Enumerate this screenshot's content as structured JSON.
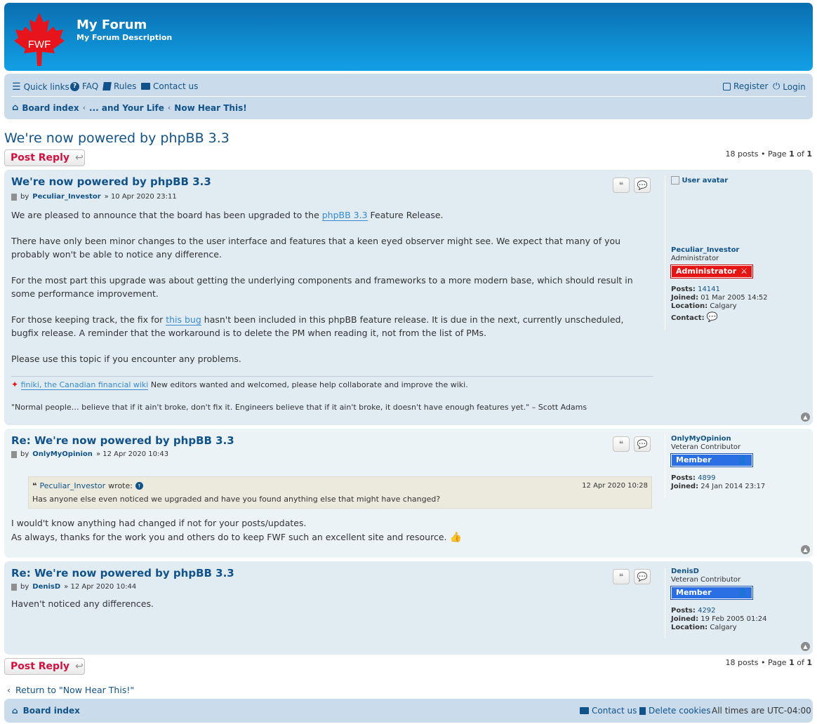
{
  "header": {
    "site_title": "My Forum",
    "site_description": "My Forum Description",
    "logo_text": "FWF"
  },
  "navbar": {
    "quick_links": "Quick links",
    "faq": "FAQ",
    "rules": "Rules",
    "contact": "Contact us",
    "register": "Register",
    "login": "Login",
    "breadcrumb": [
      "Board index",
      "... and Your Life",
      "Now Hear This!"
    ]
  },
  "topic": {
    "title": "We're now powered by phpBB 3.3",
    "post_reply": "Post Reply",
    "pagination_prefix": "18 posts • Page",
    "page_current": "1",
    "page_of": "of",
    "page_total": "1"
  },
  "posts": [
    {
      "title": "We're now powered by phpBB 3.3",
      "by": "by",
      "author": "Peculiar_Investor",
      "date": "» 10 Apr 2020 23:11",
      "p1_pre": "We are pleased to announce that the board has been upgraded to the ",
      "p1_link": "phpBB 3.3",
      "p1_post": " Feature Release.",
      "p2": "There have only been minor changes to the user interface and features that a keen eyed observer might see. We expect that many of you probably won't be able to notice any difference.",
      "p3": "For the most part this upgrade was about getting the underlying components and frameworks to a more modern base, which should result in some performance improvement.",
      "p4_pre": "For those keeping track, the fix for ",
      "p4_link": "this bug",
      "p4_post": " hasn't been included in this phpBB feature release. It is due in the next, currently unscheduled, bugfix release. A reminder that the workaround is to delete the PM when reading it, not from the list of PMs.",
      "p5": "Please use this topic if you encounter any problems.",
      "sig_link": "finiki, the Canadian financial wiki",
      "sig_text": " New editors wanted and welcomed, please help collaborate and improve the wiki.",
      "sig_quote": "\"Normal people… believe that if it ain't broke, don't fix it. Engineers believe that if it ain't broke, it doesn't have enough features yet.\" – Scott Adams",
      "profile": {
        "avatar_alt": "User avatar",
        "username": "Peculiar_Investor",
        "title": "Administrator",
        "rank": "Administrator",
        "posts_label": "Posts:",
        "posts": "14141",
        "joined_label": "Joined:",
        "joined": "01 Mar 2005 14:52",
        "location_label": "Location:",
        "location": "Calgary",
        "contact_label": "Contact:"
      }
    },
    {
      "title": "Re: We're now powered by phpBB 3.3",
      "by": "by",
      "author": "OnlyMyOpinion",
      "date": "» 12 Apr 2020 10:43",
      "quote_author": "Peculiar_Investor",
      "quote_wrote": "wrote:",
      "quote_date": "12 Apr 2020 10:28",
      "quote_text": "Has anyone else even noticed we upgraded and have you found anything else that might have changed?",
      "line1": "I would't know anything had changed if not for your posts/updates.",
      "line2": "As always, thanks for the work you and others do to keep FWF such an excellent site and resource.",
      "profile": {
        "username": "OnlyMyOpinion",
        "title": "Veteran Contributor",
        "rank": "Member",
        "posts_label": "Posts:",
        "posts": "4899",
        "joined_label": "Joined:",
        "joined": "24 Jan 2014 23:17"
      }
    },
    {
      "title": "Re: We're now powered by phpBB 3.3",
      "by": "by",
      "author": "DenisD",
      "date": "» 12 Apr 2020 10:44",
      "body": "Haven't noticed any differences.",
      "profile": {
        "username": "DenisD",
        "title": "Veteran Contributor",
        "rank": "Member",
        "posts_label": "Posts:",
        "posts": "4292",
        "joined_label": "Joined:",
        "joined": "19 Feb 2005 01:24",
        "location_label": "Location:",
        "location": "Calgary"
      }
    }
  ],
  "footer": {
    "return_link": "Return to \"Now Hear This!\"",
    "board_index": "Board index",
    "contact": "Contact us",
    "delete_cookies": "Delete cookies",
    "timezone": "All times are UTC-04:00"
  },
  "colors": {
    "header_blue": "#12a0e6",
    "nav_bg": "#cadceb",
    "post_bg_alt1": "#e1ebf2",
    "post_bg_alt2": "#ecf3f7",
    "reply_red": "#d31141",
    "admin_rank": "#e61313",
    "member_rank": "#2a6fe3",
    "link_blue": "#105289"
  }
}
